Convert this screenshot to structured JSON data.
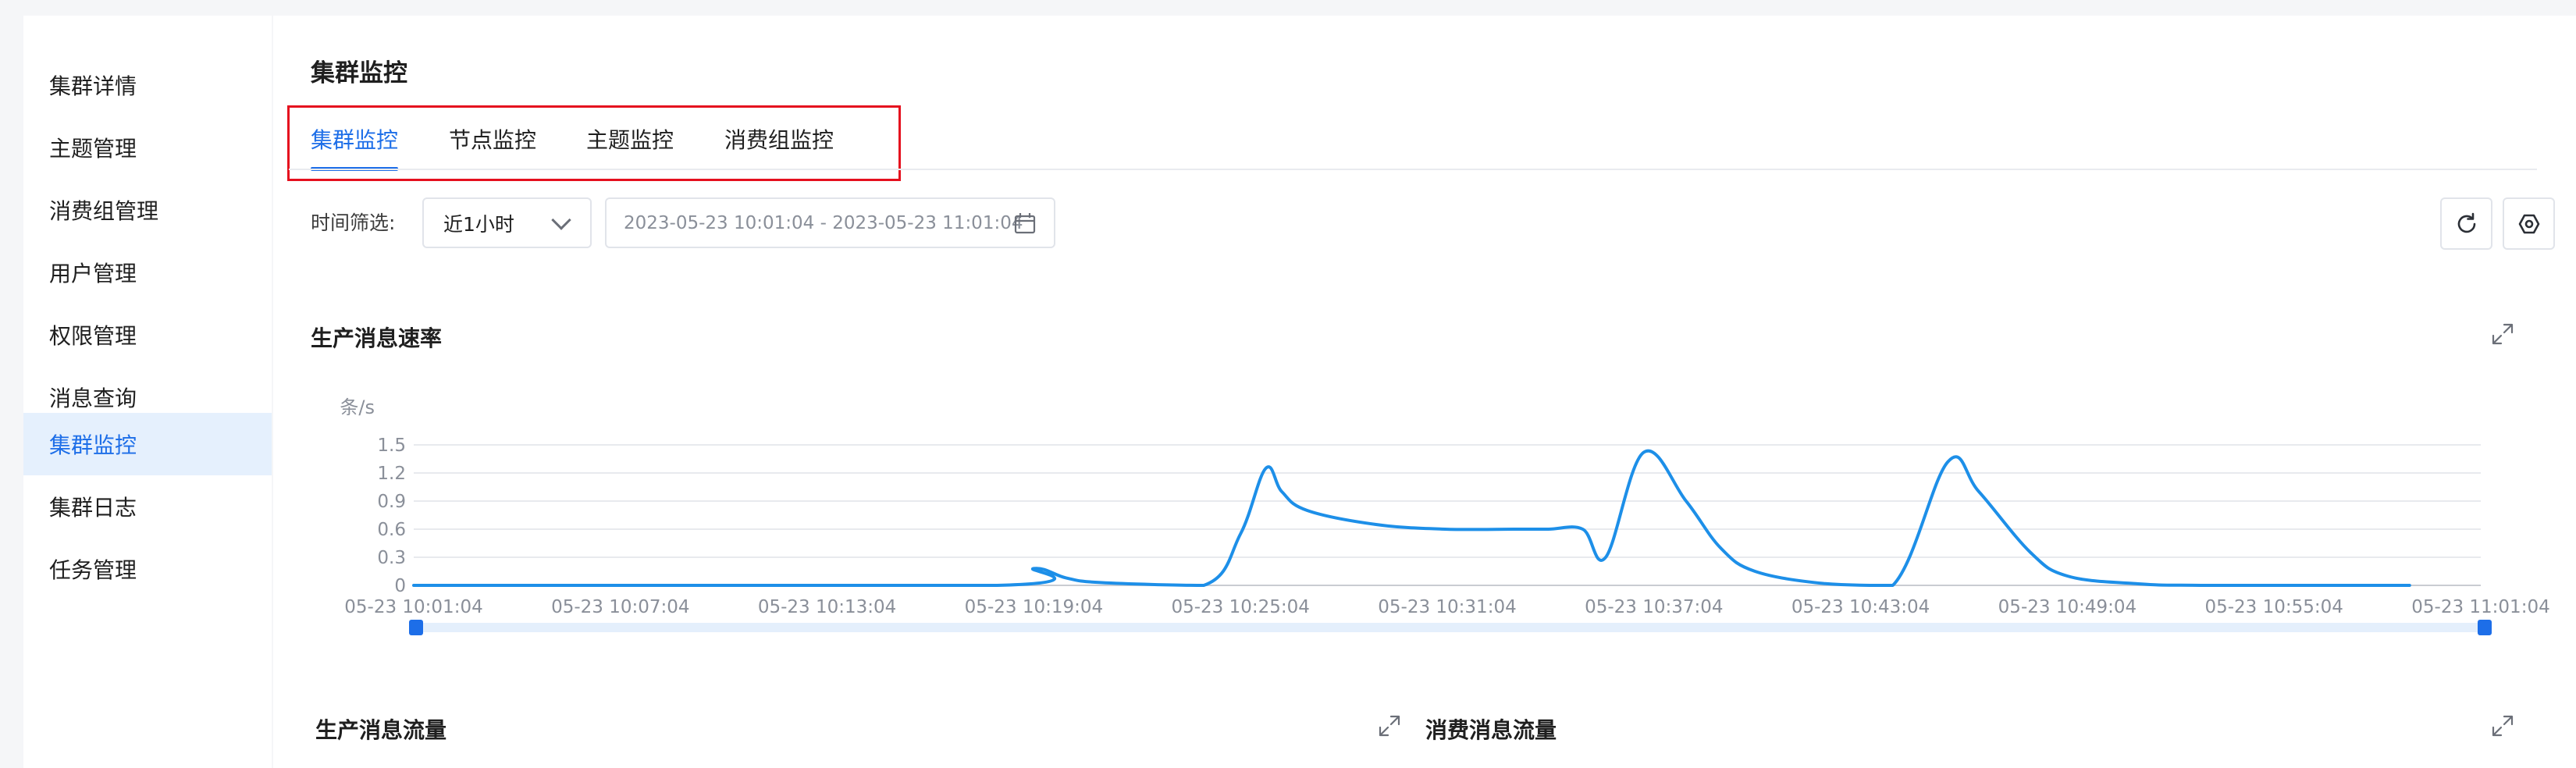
{
  "sidebar": {
    "items": [
      {
        "label": "集群详情"
      },
      {
        "label": "主题管理"
      },
      {
        "label": "消费组管理"
      },
      {
        "label": "用户管理"
      },
      {
        "label": "权限管理"
      },
      {
        "label": "消息查询"
      },
      {
        "label": "集群监控",
        "active": true
      },
      {
        "label": "集群日志"
      },
      {
        "label": "任务管理"
      }
    ]
  },
  "header": {
    "title": "集群监控"
  },
  "tabs": [
    {
      "label": "集群监控",
      "active": true
    },
    {
      "label": "节点监控"
    },
    {
      "label": "主题监控"
    },
    {
      "label": "消费组监控"
    }
  ],
  "filter": {
    "label": "时间筛选:",
    "range_select": "近1小时",
    "date_range": "2023-05-23 10:01:04 - 2023-05-23 11:01:04"
  },
  "icons": {
    "refresh": "refresh-icon",
    "settings": "settings-icon",
    "calendar": "calendar-icon",
    "expand": "expand-icon"
  },
  "colors": {
    "accent": "#1d6ee8",
    "line": "#1d8fe8",
    "highlight_border": "#e5101e"
  },
  "charts": {
    "produce_rate_title": "生产消息速率",
    "produce_flow_title": "生产消息流量",
    "consume_flow_title": "消费消息流量"
  },
  "chart_data": {
    "type": "line",
    "title": "生产消息速率",
    "ylabel": "条/s",
    "ylim": [
      0,
      1.5
    ],
    "y_ticks": [
      "0",
      "0.3",
      "0.6",
      "0.9",
      "1.2",
      "1.5"
    ],
    "x_ticks": [
      "05-23 10:01:04",
      "05-23 10:07:04",
      "05-23 10:13:04",
      "05-23 10:19:04",
      "05-23 10:25:04",
      "05-23 10:31:04",
      "05-23 10:37:04",
      "05-23 10:43:04",
      "05-23 10:49:04",
      "05-23 10:55:04",
      "05-23 11:01:04"
    ],
    "xlim": [
      "05-23 10:01:04",
      "05-23 11:01:04"
    ],
    "grid": true,
    "series": [
      {
        "x": [
          "05-23 10:01:04",
          "05-23 10:18:00",
          "05-23 10:19:04",
          "05-23 10:20:00",
          "05-23 10:21:00",
          "05-23 10:24:00",
          "05-23 10:25:04",
          "05-23 10:25:48",
          "05-23 10:26:16",
          "05-23 10:27:00",
          "05-23 10:29:00",
          "05-23 10:31:00",
          "05-23 10:33:00",
          "05-23 10:34:00",
          "05-23 10:35:00",
          "05-23 10:35:40",
          "05-23 10:36:46",
          "05-23 10:38:00",
          "05-23 10:39:00",
          "05-23 10:40:00",
          "05-23 10:42:00",
          "05-23 10:44:00",
          "05-23 10:45:36",
          "05-23 10:46:30",
          "05-23 10:48:00",
          "05-23 10:49:04",
          "05-23 10:51:00",
          "05-23 10:53:00",
          "05-23 10:59:00"
        ],
        "y": [
          0,
          0,
          0.18,
          0.08,
          0.03,
          0,
          0.55,
          1.25,
          1.0,
          0.8,
          0.65,
          0.6,
          0.6,
          0.6,
          0.6,
          0.3,
          1.42,
          0.9,
          0.4,
          0.15,
          0.02,
          0,
          1.32,
          1.0,
          0.35,
          0.1,
          0.02,
          0,
          0
        ]
      }
    ]
  }
}
